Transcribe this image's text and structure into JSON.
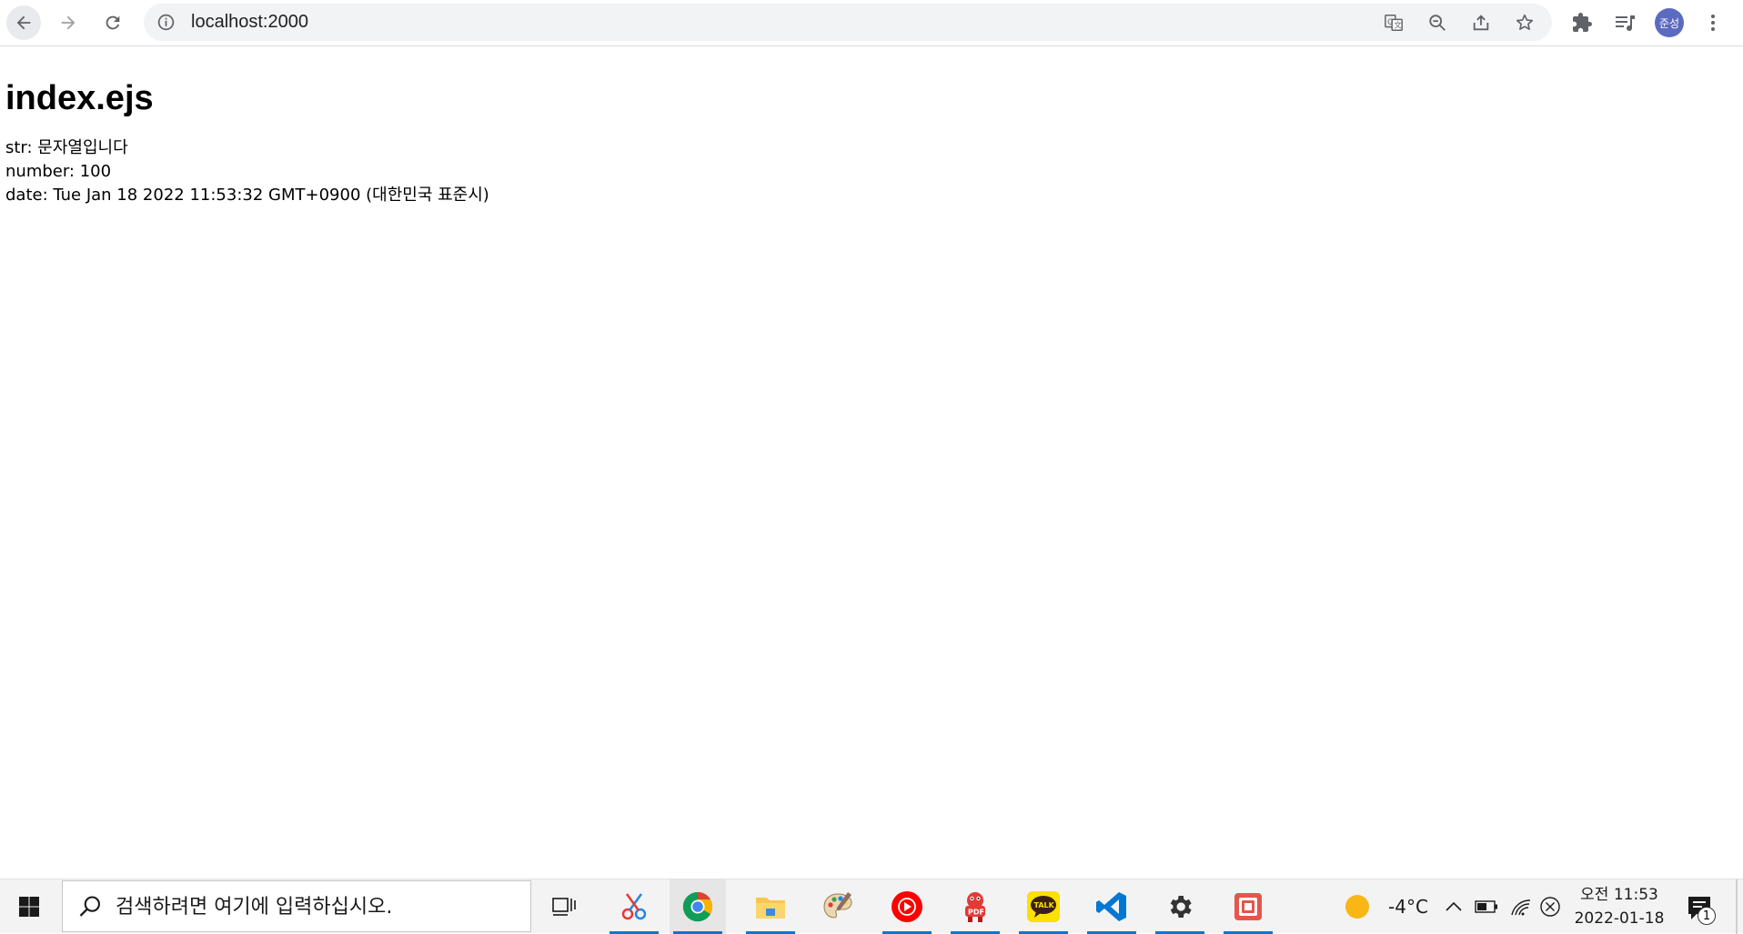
{
  "browser": {
    "url": "localhost:2000",
    "profile_initials": "준성"
  },
  "page": {
    "title": "index.ejs",
    "lines": [
      "str: 문자열입니다",
      "number: 100",
      "date: Tue Jan 18 2022 11:53:32 GMT+0900 (대한민국 표준시)"
    ]
  },
  "taskbar": {
    "search_placeholder": "검색하려면 여기에 입력하십시오.",
    "weather_temp": "-4°C",
    "clock_time": "오전 11:53",
    "clock_date": "2022-01-18",
    "notification_count": "1"
  },
  "colors": {
    "accent": "#0078d4",
    "avatar": "#5c6bc0",
    "omnibox": "#f1f3f4"
  }
}
